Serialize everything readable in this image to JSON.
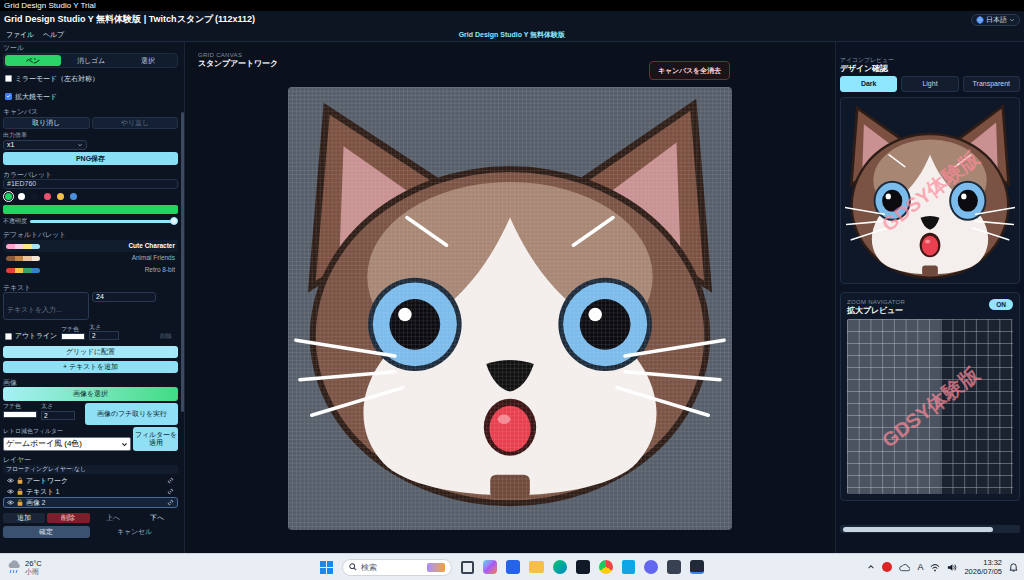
{
  "window": {
    "title": "Grid Design Studio Y Trial"
  },
  "header": {
    "title": "Grid Design Studio Y 無料体験版 | Twitchスタンプ (112x112)",
    "language": "日本語"
  },
  "menu": {
    "items": [
      "ファイル",
      "ヘルプ"
    ],
    "center_title": "Grid Design Studio Y 無料体験版"
  },
  "tools": {
    "label": "ツール",
    "tabs": [
      {
        "label": "ペン",
        "selected": true
      },
      {
        "label": "消しゴム",
        "selected": false
      },
      {
        "label": "選択",
        "selected": false
      }
    ],
    "options": [
      {
        "label": "ミラーモード（左右対称）",
        "checked": false
      },
      {
        "label": "拡大鏡モード",
        "checked": true
      }
    ]
  },
  "canvas_panel": {
    "label": "キャンバス",
    "undo": {
      "label": "取り消し",
      "disabled": false
    },
    "redo": {
      "label": "やり直し",
      "disabled": true
    },
    "scale_label": "出力倍率",
    "scale_value": "x1",
    "save_button": "PNG保存"
  },
  "palette": {
    "label": "カラーパレット",
    "hex": "#1ED760",
    "swatches": [
      {
        "color": "#1ed760",
        "selected": true
      },
      {
        "color": "#ffffff",
        "selected": false
      },
      {
        "color": "#111827",
        "selected": false
      },
      {
        "color": "#f0506e",
        "selected": false
      },
      {
        "color": "#f5c04a",
        "selected": false
      },
      {
        "color": "#4a90e2",
        "selected": false
      }
    ],
    "current_color": "#1ed760",
    "opacity_label": "不透明度",
    "opacity": 1
  },
  "default_palettes": {
    "label": "デフォルトパレット",
    "items": [
      {
        "name": "Cute Character",
        "selected": true,
        "colors": [
          "#f9a8c9",
          "#fbcfe8",
          "#fde68a",
          "#a5e4f3"
        ]
      },
      {
        "name": "Animal Friends",
        "selected": false,
        "colors": [
          "#8b5a3c",
          "#c08552",
          "#e8c39e",
          "#f5e6d3"
        ]
      },
      {
        "name": "Retro 8-bit",
        "selected": false,
        "colors": [
          "#e53e3e",
          "#f6c343",
          "#38a169",
          "#3182ce"
        ]
      }
    ]
  },
  "text_panel": {
    "label": "テキスト",
    "placeholder": "テキストを入力...",
    "size": "24",
    "outline": {
      "label": "アウトライン",
      "checked": false
    },
    "edge_color_label": "フチ色",
    "edge_color": "#ffffff",
    "width_label": "太さ",
    "width": "2",
    "delete": {
      "label": "削除",
      "disabled": true
    },
    "align_button": "グリッドに配置",
    "add_button": "+ テキストを追加"
  },
  "image_panel": {
    "label": "画像",
    "select_button": "画像を選択",
    "edge_color_label": "フチ色",
    "edge_color": "#ffffff",
    "width_label": "太さ",
    "width": "2",
    "outline_button": "画像のフチ取りを実行",
    "filter_label": "レトロ減色フィルター",
    "filter_value": "ゲームボーイ風 (4色)",
    "filter_button": "フィルターを適用"
  },
  "layers": {
    "label": "レイヤー",
    "floating": "フローティングレイヤー:なし",
    "items": [
      {
        "name": "アートワーク",
        "selected": false
      },
      {
        "name": "テキスト 1",
        "selected": false
      },
      {
        "name": "画像 2",
        "selected": true
      }
    ],
    "buttons": {
      "add": "追加",
      "delete": "削除",
      "up": "上へ",
      "down": "下へ"
    },
    "confirm": "確定",
    "cancel": "キャンセル"
  },
  "canvas": {
    "label": "GRID CANVAS",
    "title": "スタンプアートワーク",
    "clear_button": "キャンバスを全消去"
  },
  "preview": {
    "label": "アイコンプレビュー",
    "title": "デザイン確認",
    "tabs": [
      {
        "label": "Dark",
        "selected": true
      },
      {
        "label": "Light",
        "selected": false
      },
      {
        "label": "Transparent",
        "selected": false
      }
    ],
    "watermark": "GDSY体験版"
  },
  "zoom": {
    "label": "ZOOM NAVIGATOR",
    "title": "拡大プレビュー",
    "toggle": {
      "label": "ON",
      "on": true
    },
    "watermark": "GDSY体験版"
  },
  "taskbar": {
    "weather": {
      "temp": "26°C",
      "condition": "小雨"
    },
    "search": "検索",
    "ime": "A",
    "time": "13:32",
    "date": "2026/07/05"
  }
}
